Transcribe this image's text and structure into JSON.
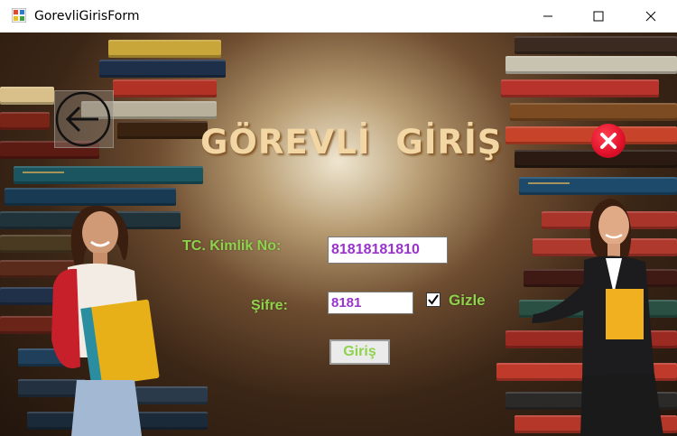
{
  "window": {
    "title": "GorevliGirisForm",
    "controls": [
      "minimize",
      "maximize",
      "close"
    ]
  },
  "form": {
    "header": "GÖREVLİ  GİRİŞ",
    "tc_label": "TC. Kimlik No:",
    "tc_value": "81818181810",
    "sifre_label": "Şifre:",
    "sifre_value": "8181",
    "gizle_label": "Gizle",
    "gizle_checked": true,
    "login_button": "Giriş"
  },
  "icons": {
    "back": "arrow-left-circle-icon",
    "close": "red-circle-x-icon"
  },
  "colors": {
    "label_green": "#8fd24c",
    "input_text": "#9933cc",
    "header_cream": "#f2d6a4",
    "close_red": "#e0102a"
  }
}
